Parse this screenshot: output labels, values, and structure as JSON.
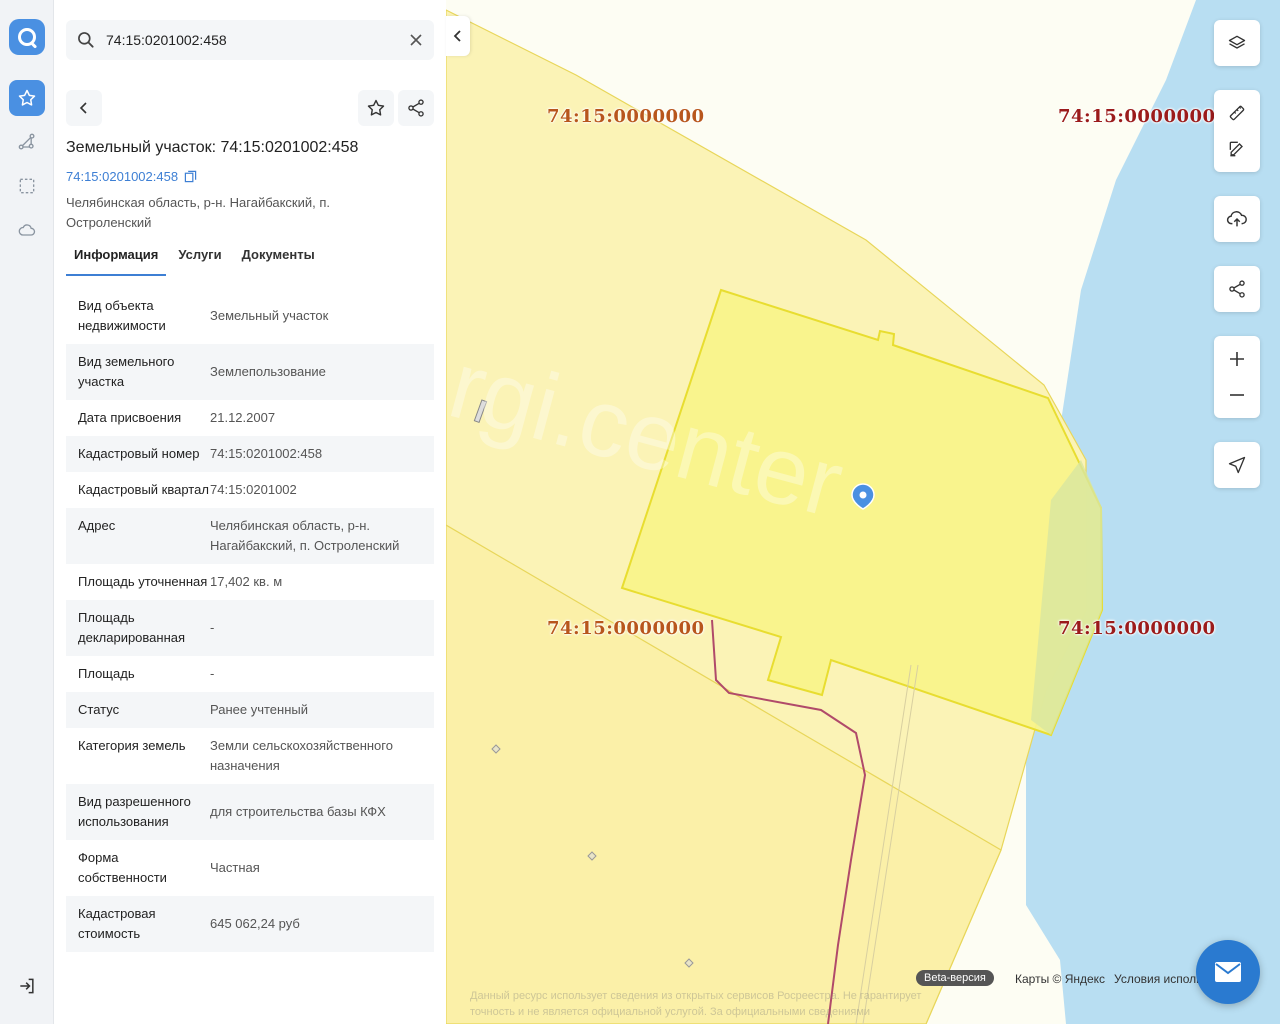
{
  "search": {
    "value": "74:15:0201002:458"
  },
  "object": {
    "title": "Земельный участок: 74:15:0201002:458",
    "cadastral_link": "74:15:0201002:458",
    "address": "Челябинская область, р-н. Нагайбакский, п. Остроленский"
  },
  "tabs": [
    {
      "label": "Информация",
      "active": true
    },
    {
      "label": "Услуги",
      "active": false
    },
    {
      "label": "Документы",
      "active": false
    }
  ],
  "info_rows": [
    {
      "key": "Вид объекта недвижимости",
      "value": "Земельный участок"
    },
    {
      "key": "Вид земельного участка",
      "value": "Землепользование"
    },
    {
      "key": "Дата присвоения",
      "value": "21.12.2007"
    },
    {
      "key": "Кадастровый номер",
      "value": "74:15:0201002:458"
    },
    {
      "key": "Кадастровый квартал",
      "value": "74:15:0201002"
    },
    {
      "key": "Адрес",
      "value": "Челябинская область, р-н. Нагайбакский, п. Остроленский"
    },
    {
      "key": "Площадь уточненная",
      "value": "17,402 кв. м"
    },
    {
      "key": "Площадь декларированная",
      "value": "-"
    },
    {
      "key": "Площадь",
      "value": "-"
    },
    {
      "key": "Статус",
      "value": "Ранее учтенный"
    },
    {
      "key": "Категория земель",
      "value": "Земли сельскохозяйственного назначения"
    },
    {
      "key": "Вид разрешенного использования",
      "value": "для строительства базы КФХ"
    },
    {
      "key": "Форма собственности",
      "value": "Частная"
    },
    {
      "key": "Кадастровая стоимость",
      "value": "645 062,24 руб"
    }
  ],
  "map": {
    "labels": [
      "74:15:0000000",
      "74:15:0000000",
      "74:15:0000000",
      "74:15:0000000"
    ],
    "watermark": "rgi.center",
    "beta": "Beta-версия",
    "attribution": "Карты © Яндекс",
    "terms": "Условия использования",
    "disclaimer": "Данный ресурс использует сведения из открытых сервисов Росреестра. Не гарантирует точность и не является официальной услугой. За официальными сведениями"
  },
  "colors": {
    "accent": "#4a90e2",
    "parcel_fill": "#f9f48a",
    "water": "#b8def2",
    "label_brown": "#b8561c",
    "label_red": "#9b1b1b"
  },
  "icons": {
    "rail": [
      "logo-icon",
      "star-icon",
      "route-icon",
      "selection-icon",
      "cloud-icon",
      "logout-icon"
    ],
    "map_controls": [
      "layers-icon",
      "ruler-icon",
      "edit-icon",
      "upload-icon",
      "share-icon",
      "plus-icon",
      "minus-icon",
      "location-icon"
    ]
  }
}
